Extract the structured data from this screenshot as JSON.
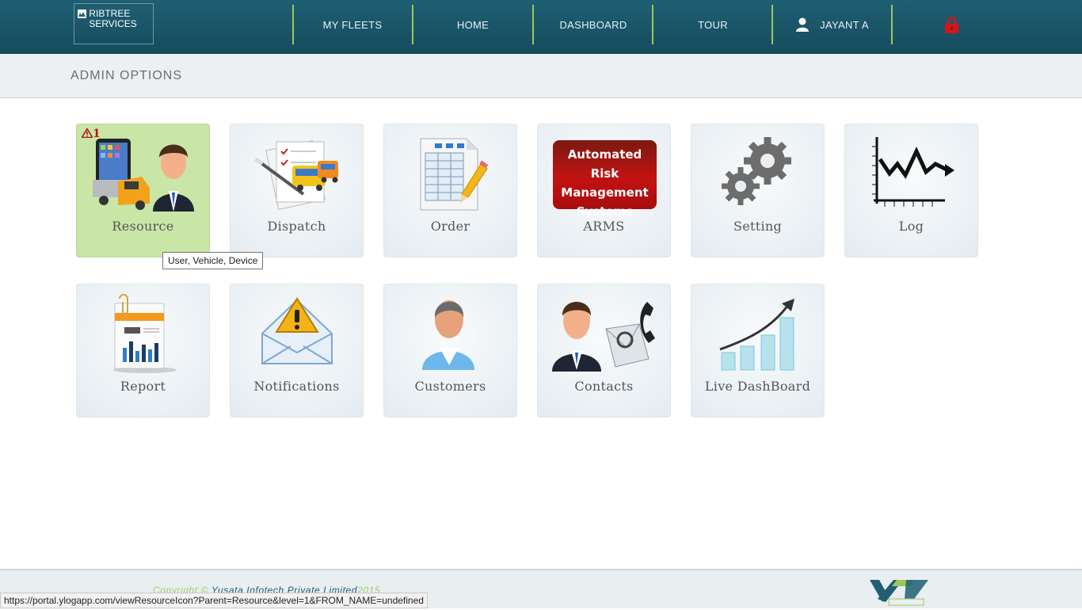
{
  "brand": {
    "text": "RIBTREE SERVICES",
    "icon": "company-logo-icon"
  },
  "nav": {
    "items": [
      "MY FLEETS",
      "HOME",
      "DASHBOARD",
      "TOUR"
    ],
    "user": "JAYANT A",
    "user_icon": "user-icon",
    "logout_icon": "lock-icon",
    "separator_color": "#9fc65a",
    "bar_color": "#1f5f73"
  },
  "page_title": "ADMIN OPTIONS",
  "tiles": [
    {
      "label": "Resource",
      "icon": "resource-icon",
      "badge": "1"
    },
    {
      "label": "Dispatch",
      "icon": "dispatch-icon"
    },
    {
      "label": "Order",
      "icon": "order-icon"
    },
    {
      "label": "ARMS",
      "icon": "arms-icon",
      "icon_text": [
        "Automated Risk",
        "Management",
        "Systems"
      ]
    },
    {
      "label": "Setting",
      "icon": "gears-icon"
    },
    {
      "label": "Log",
      "icon": "log-chart-icon"
    },
    {
      "label": "Report",
      "icon": "report-icon"
    },
    {
      "label": "Notifications",
      "icon": "envelope-warning-icon"
    },
    {
      "label": "Customers",
      "icon": "customer-icon"
    },
    {
      "label": "Contacts",
      "icon": "contacts-icon"
    },
    {
      "label": "Live DashBoard",
      "icon": "growth-chart-icon"
    }
  ],
  "tooltip": "User, Vehicle, Device",
  "footer": {
    "copyright_prefix": "Copyright © ",
    "company": "Yusata Infotech Private Limited",
    "year": "2015",
    "logo_icon": "ylog-logo-icon"
  },
  "status_url": "https://portal.ylogapp.com/viewResourceIcon?Parent=Resource&level=1&FROM_NAME=undefined"
}
